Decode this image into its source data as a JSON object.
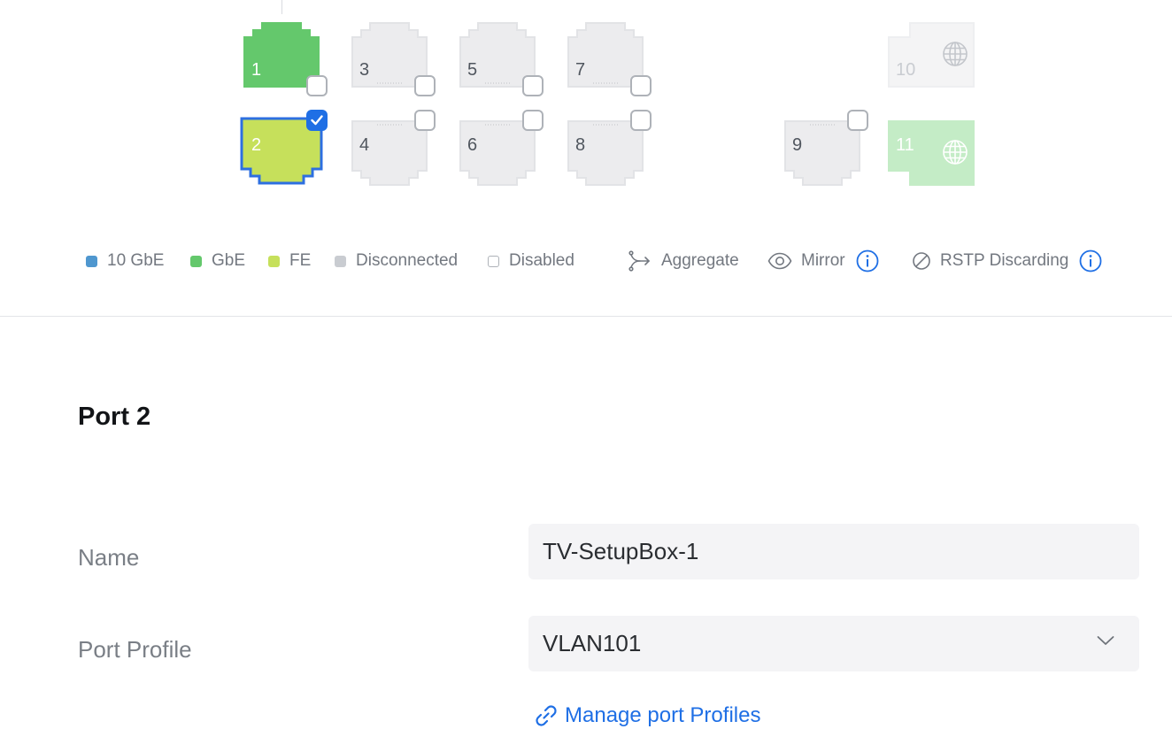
{
  "ports": [
    {
      "id": 1,
      "label": "1",
      "status": "GbE",
      "checked": false,
      "fill": "#64c86c"
    },
    {
      "id": 2,
      "label": "2",
      "status": "FE",
      "checked": true,
      "selected": true,
      "fill": "#c6e05b",
      "border": "#2d6fe0"
    },
    {
      "id": 3,
      "label": "3",
      "status": "Disconnected",
      "checked": false,
      "fill": "#ececee"
    },
    {
      "id": 4,
      "label": "4",
      "status": "Disconnected",
      "checked": false,
      "fill": "#ececee"
    },
    {
      "id": 5,
      "label": "5",
      "status": "Disconnected",
      "checked": false,
      "fill": "#ececee"
    },
    {
      "id": 6,
      "label": "6",
      "status": "Disconnected",
      "checked": false,
      "fill": "#ececee"
    },
    {
      "id": 7,
      "label": "7",
      "status": "Disconnected",
      "checked": false,
      "fill": "#ececee"
    },
    {
      "id": 8,
      "label": "8",
      "status": "Disconnected",
      "checked": false,
      "fill": "#ececee"
    },
    {
      "id": 9,
      "label": "9",
      "status": "Disconnected",
      "checked": false,
      "fill": "#ececee"
    },
    {
      "id": 10,
      "label": "10",
      "status": "Disconnected",
      "icon": "globe-icon",
      "fill": "#f4f4f5"
    },
    {
      "id": 11,
      "label": "11",
      "status": "GbE",
      "icon": "globe-icon",
      "fill": "#c4ecc6"
    }
  ],
  "legend": {
    "items": [
      {
        "label": "10 GbE",
        "color": "#4f97cf"
      },
      {
        "label": "GbE",
        "color": "#64c86c"
      },
      {
        "label": "FE",
        "color": "#c6e05b"
      },
      {
        "label": "Disconnected",
        "color": "#c9ccd1"
      },
      {
        "label": "Disabled",
        "color": "#ffffff"
      }
    ],
    "aggregate": "Aggregate",
    "mirror": "Mirror",
    "rstp": "RSTP Discarding"
  },
  "detail": {
    "title": "Port 2",
    "name_label": "Name",
    "name_value": "TV-SetupBox-1",
    "profile_label": "Port Profile",
    "profile_value": "VLAN101",
    "manage_link": "Manage port Profiles"
  },
  "colors": {
    "accent": "#1f6fe5"
  }
}
